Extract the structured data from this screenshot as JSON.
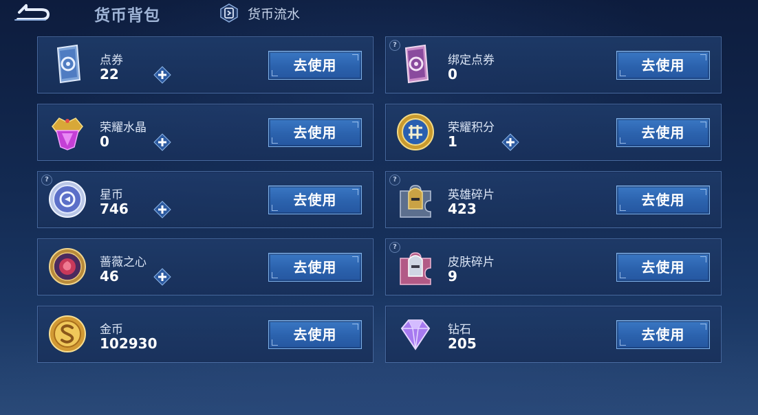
{
  "header": {
    "title": "货币背包",
    "flow_label": "货币流水"
  },
  "action_label": "去使用",
  "currencies": [
    {
      "name": "点券",
      "value": "22",
      "has_plus": true,
      "has_help": false,
      "icon": "coupon-ticket-icon"
    },
    {
      "name": "绑定点券",
      "value": "0",
      "has_plus": false,
      "has_help": true,
      "icon": "bound-coupon-icon"
    },
    {
      "name": "荣耀水晶",
      "value": "0",
      "has_plus": true,
      "has_help": false,
      "icon": "glory-crystal-icon"
    },
    {
      "name": "荣耀积分",
      "value": "1",
      "has_plus": true,
      "has_help": false,
      "icon": "glory-points-icon"
    },
    {
      "name": "星币",
      "value": "746",
      "has_plus": true,
      "has_help": true,
      "icon": "star-coin-icon"
    },
    {
      "name": "英雄碎片",
      "value": "423",
      "has_plus": false,
      "has_help": true,
      "icon": "hero-shard-icon"
    },
    {
      "name": "蔷薇之心",
      "value": "46",
      "has_plus": true,
      "has_help": false,
      "icon": "rose-heart-icon"
    },
    {
      "name": "皮肤碎片",
      "value": "9",
      "has_plus": false,
      "has_help": true,
      "icon": "skin-shard-icon"
    },
    {
      "name": "金币",
      "value": "102930",
      "has_plus": false,
      "has_help": false,
      "icon": "gold-coin-icon"
    },
    {
      "name": "钻石",
      "value": "205",
      "has_plus": false,
      "has_help": false,
      "icon": "diamond-icon"
    }
  ],
  "colors": {
    "background": "#132a52",
    "card": "#1e3a68",
    "button": "#2b62ad",
    "button_border": "#7fb2ea"
  }
}
